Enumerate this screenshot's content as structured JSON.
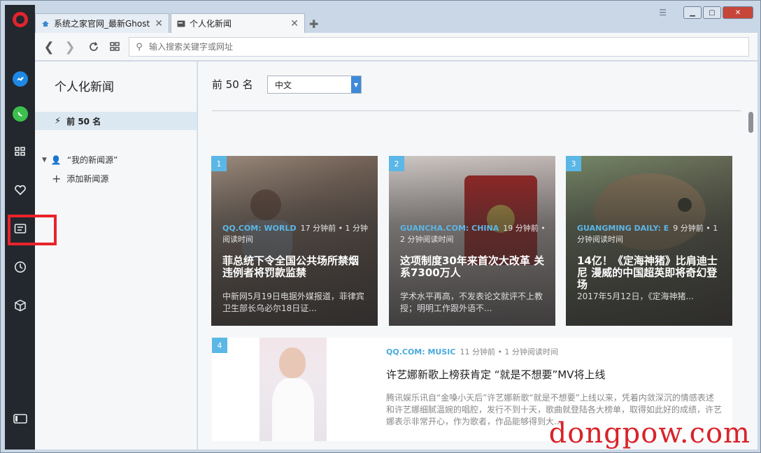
{
  "tabs": [
    {
      "label": "系统之家官网_最新Ghost",
      "active": false
    },
    {
      "label": "个人化新闻",
      "active": true
    }
  ],
  "addressbar": {
    "placeholder": "输入搜索关键字或网址"
  },
  "news_panel": {
    "title": "个人化新闻",
    "top50_label": "前 50 名",
    "source_label": "“我的新闻源”",
    "add_source_label": "添加新闻源"
  },
  "main": {
    "heading": "前 50 名",
    "language": "中文"
  },
  "cards": [
    {
      "number": "1",
      "source": "QQ.COM: WORLD",
      "time": "17 分钟前 • 1 分钟阅读时间",
      "title": "菲总统下令全国公共场所禁烟 违例者将罚款监禁",
      "excerpt": "中新网5月19日电据外媒报道，菲律宾卫生部长乌必尔18日证..."
    },
    {
      "number": "2",
      "source": "GUANCHA.COM: CHINA",
      "time": "19 分钟前 • 2 分钟阅读时间",
      "title": "这项制度30年来首次大改革 关系7300万人",
      "excerpt": "学术水平再高，不发表论文就评不上教授；明明工作跟外语不..."
    },
    {
      "number": "3",
      "source": "GUANGMING DAILY: E",
      "time": "9 分钟前 • 1 分钟阅读时间",
      "title": "14亿！《定海神猪》比肩迪士尼 漫威的中国超英即将奇幻登场",
      "excerpt": "2017年5月12日，《定海神猪..."
    }
  ],
  "card4": {
    "number": "4",
    "source": "QQ.COM: MUSIC",
    "time": "11 分钟前 • 1 分钟阅读时间",
    "title": "许艺娜新歌上榜获肯定 “就是不想要”MV将上线",
    "excerpt": "腾讯娱乐讯自“金嗓小天后”许艺娜新歌“就是不想要”上线以来，凭着内敛深沉的情感表述和许艺娜细腻温婉的唱腔，发行不到十天，歌曲就登陆各大榜单，取得如此好的成绩，许艺娜表示非常开心，作为歌者，作品能够得到大..."
  },
  "watermark": "dongpow.com",
  "colors": {
    "accent": "#5bb7e6",
    "sidebar": "#23272e",
    "highlight": "#e8232a"
  }
}
